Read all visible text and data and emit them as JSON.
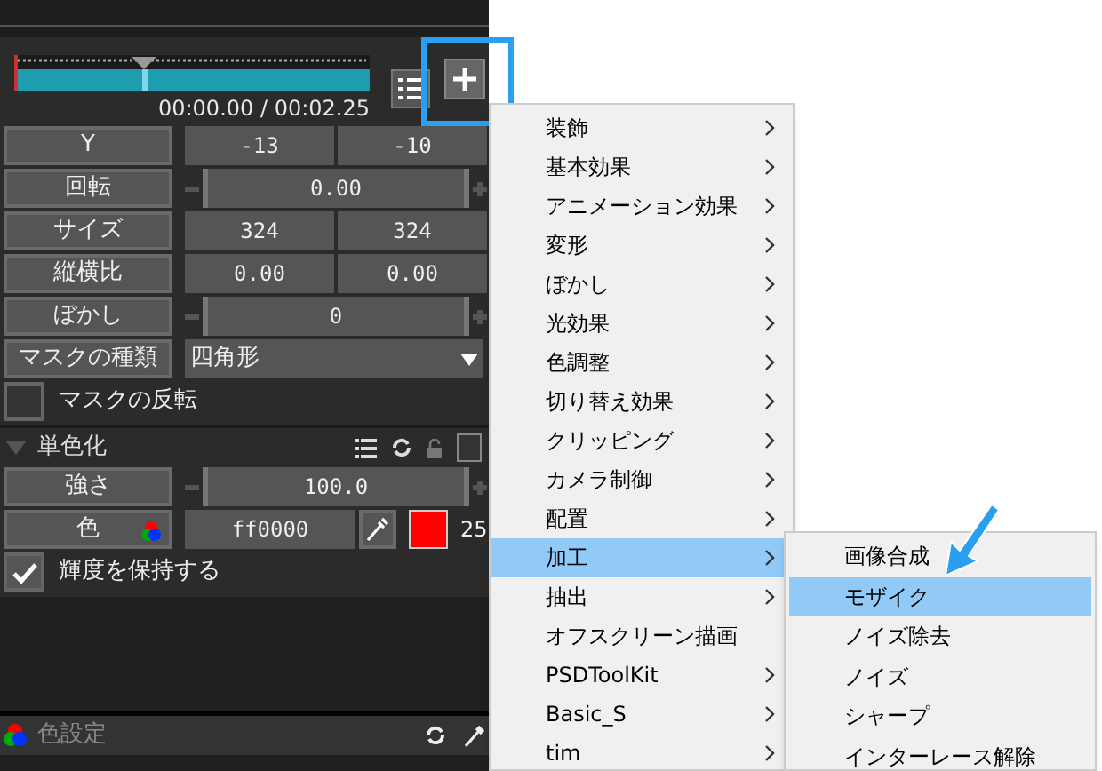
{
  "timeline": {
    "time": "00:00.00 / 00:02.25"
  },
  "params": [
    {
      "kind": "pair",
      "label": "Y",
      "values": [
        "-13",
        "-10"
      ]
    },
    {
      "kind": "slider",
      "label": "回転",
      "value": "0.00"
    },
    {
      "kind": "pair",
      "label": "サイズ",
      "values": [
        "324",
        "324"
      ]
    },
    {
      "kind": "pair",
      "label": "縦横比",
      "values": [
        "0.00",
        "0.00"
      ]
    },
    {
      "kind": "slider",
      "label": "ぼかし",
      "value": "0"
    },
    {
      "kind": "select",
      "label": "マスクの種類",
      "value": "四角形"
    },
    {
      "kind": "checkbox",
      "label": "マスクの反転",
      "checked": false
    }
  ],
  "section": {
    "title": "単色化",
    "expanded": true,
    "checked": false
  },
  "section_params": [
    {
      "kind": "slider",
      "label": "強さ",
      "value": "100.0"
    },
    {
      "kind": "color",
      "label": "色",
      "value": "ff0000",
      "color": "#ff0000",
      "extra": "25"
    },
    {
      "kind": "checkbox",
      "label": "輝度を保持する",
      "checked": true
    }
  ],
  "bottom_bar": {
    "title": "色設定"
  },
  "menu": [
    {
      "label": "装飾",
      "submenu": true,
      "selected": false
    },
    {
      "label": "基本効果",
      "submenu": true,
      "selected": false
    },
    {
      "label": "アニメーション効果",
      "submenu": true,
      "selected": false
    },
    {
      "label": "変形",
      "submenu": true,
      "selected": false
    },
    {
      "label": "ぼかし",
      "submenu": true,
      "selected": false
    },
    {
      "label": "光効果",
      "submenu": true,
      "selected": false
    },
    {
      "label": "色調整",
      "submenu": true,
      "selected": false
    },
    {
      "label": "切り替え効果",
      "submenu": true,
      "selected": false
    },
    {
      "label": "クリッピング",
      "submenu": true,
      "selected": false
    },
    {
      "label": "カメラ制御",
      "submenu": true,
      "selected": false
    },
    {
      "label": "配置",
      "submenu": true,
      "selected": false
    },
    {
      "label": "加工",
      "submenu": true,
      "selected": true
    },
    {
      "label": "抽出",
      "submenu": true,
      "selected": false
    },
    {
      "label": "オフスクリーン描画",
      "submenu": false,
      "selected": false
    },
    {
      "label": "PSDToolKit",
      "submenu": true,
      "selected": false
    },
    {
      "label": "Basic_S",
      "submenu": true,
      "selected": false
    },
    {
      "label": "tim",
      "submenu": true,
      "selected": false
    }
  ],
  "submenu": [
    {
      "label": "画像合成",
      "selected": false
    },
    {
      "label": "モザイク",
      "selected": true
    },
    {
      "label": "ノイズ除去",
      "selected": false
    },
    {
      "label": "ノイズ",
      "selected": false
    },
    {
      "label": "シャープ",
      "selected": false
    },
    {
      "label": "インターレース解除",
      "selected": false
    }
  ]
}
